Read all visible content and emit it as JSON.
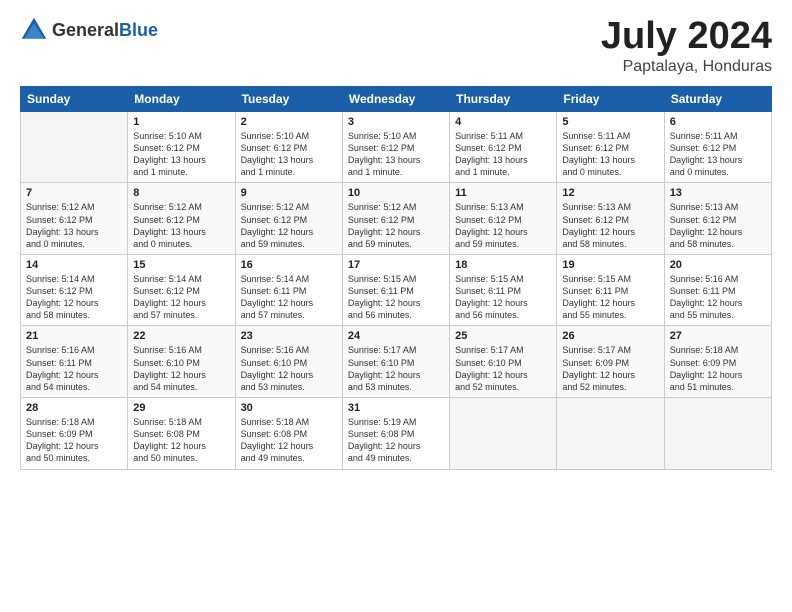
{
  "logo": {
    "general": "General",
    "blue": "Blue"
  },
  "header": {
    "month": "July 2024",
    "location": "Paptalaya, Honduras"
  },
  "weekdays": [
    "Sunday",
    "Monday",
    "Tuesday",
    "Wednesday",
    "Thursday",
    "Friday",
    "Saturday"
  ],
  "weeks": [
    [
      {
        "day": "",
        "info": ""
      },
      {
        "day": "1",
        "info": "Sunrise: 5:10 AM\nSunset: 6:12 PM\nDaylight: 13 hours\nand 1 minute."
      },
      {
        "day": "2",
        "info": "Sunrise: 5:10 AM\nSunset: 6:12 PM\nDaylight: 13 hours\nand 1 minute."
      },
      {
        "day": "3",
        "info": "Sunrise: 5:10 AM\nSunset: 6:12 PM\nDaylight: 13 hours\nand 1 minute."
      },
      {
        "day": "4",
        "info": "Sunrise: 5:11 AM\nSunset: 6:12 PM\nDaylight: 13 hours\nand 1 minute."
      },
      {
        "day": "5",
        "info": "Sunrise: 5:11 AM\nSunset: 6:12 PM\nDaylight: 13 hours\nand 0 minutes."
      },
      {
        "day": "6",
        "info": "Sunrise: 5:11 AM\nSunset: 6:12 PM\nDaylight: 13 hours\nand 0 minutes."
      }
    ],
    [
      {
        "day": "7",
        "info": "Sunrise: 5:12 AM\nSunset: 6:12 PM\nDaylight: 13 hours\nand 0 minutes."
      },
      {
        "day": "8",
        "info": "Sunrise: 5:12 AM\nSunset: 6:12 PM\nDaylight: 13 hours\nand 0 minutes."
      },
      {
        "day": "9",
        "info": "Sunrise: 5:12 AM\nSunset: 6:12 PM\nDaylight: 12 hours\nand 59 minutes."
      },
      {
        "day": "10",
        "info": "Sunrise: 5:12 AM\nSunset: 6:12 PM\nDaylight: 12 hours\nand 59 minutes."
      },
      {
        "day": "11",
        "info": "Sunrise: 5:13 AM\nSunset: 6:12 PM\nDaylight: 12 hours\nand 59 minutes."
      },
      {
        "day": "12",
        "info": "Sunrise: 5:13 AM\nSunset: 6:12 PM\nDaylight: 12 hours\nand 58 minutes."
      },
      {
        "day": "13",
        "info": "Sunrise: 5:13 AM\nSunset: 6:12 PM\nDaylight: 12 hours\nand 58 minutes."
      }
    ],
    [
      {
        "day": "14",
        "info": "Sunrise: 5:14 AM\nSunset: 6:12 PM\nDaylight: 12 hours\nand 58 minutes."
      },
      {
        "day": "15",
        "info": "Sunrise: 5:14 AM\nSunset: 6:12 PM\nDaylight: 12 hours\nand 57 minutes."
      },
      {
        "day": "16",
        "info": "Sunrise: 5:14 AM\nSunset: 6:11 PM\nDaylight: 12 hours\nand 57 minutes."
      },
      {
        "day": "17",
        "info": "Sunrise: 5:15 AM\nSunset: 6:11 PM\nDaylight: 12 hours\nand 56 minutes."
      },
      {
        "day": "18",
        "info": "Sunrise: 5:15 AM\nSunset: 6:11 PM\nDaylight: 12 hours\nand 56 minutes."
      },
      {
        "day": "19",
        "info": "Sunrise: 5:15 AM\nSunset: 6:11 PM\nDaylight: 12 hours\nand 55 minutes."
      },
      {
        "day": "20",
        "info": "Sunrise: 5:16 AM\nSunset: 6:11 PM\nDaylight: 12 hours\nand 55 minutes."
      }
    ],
    [
      {
        "day": "21",
        "info": "Sunrise: 5:16 AM\nSunset: 6:11 PM\nDaylight: 12 hours\nand 54 minutes."
      },
      {
        "day": "22",
        "info": "Sunrise: 5:16 AM\nSunset: 6:10 PM\nDaylight: 12 hours\nand 54 minutes."
      },
      {
        "day": "23",
        "info": "Sunrise: 5:16 AM\nSunset: 6:10 PM\nDaylight: 12 hours\nand 53 minutes."
      },
      {
        "day": "24",
        "info": "Sunrise: 5:17 AM\nSunset: 6:10 PM\nDaylight: 12 hours\nand 53 minutes."
      },
      {
        "day": "25",
        "info": "Sunrise: 5:17 AM\nSunset: 6:10 PM\nDaylight: 12 hours\nand 52 minutes."
      },
      {
        "day": "26",
        "info": "Sunrise: 5:17 AM\nSunset: 6:09 PM\nDaylight: 12 hours\nand 52 minutes."
      },
      {
        "day": "27",
        "info": "Sunrise: 5:18 AM\nSunset: 6:09 PM\nDaylight: 12 hours\nand 51 minutes."
      }
    ],
    [
      {
        "day": "28",
        "info": "Sunrise: 5:18 AM\nSunset: 6:09 PM\nDaylight: 12 hours\nand 50 minutes."
      },
      {
        "day": "29",
        "info": "Sunrise: 5:18 AM\nSunset: 6:08 PM\nDaylight: 12 hours\nand 50 minutes."
      },
      {
        "day": "30",
        "info": "Sunrise: 5:18 AM\nSunset: 6:08 PM\nDaylight: 12 hours\nand 49 minutes."
      },
      {
        "day": "31",
        "info": "Sunrise: 5:19 AM\nSunset: 6:08 PM\nDaylight: 12 hours\nand 49 minutes."
      },
      {
        "day": "",
        "info": ""
      },
      {
        "day": "",
        "info": ""
      },
      {
        "day": "",
        "info": ""
      }
    ]
  ]
}
